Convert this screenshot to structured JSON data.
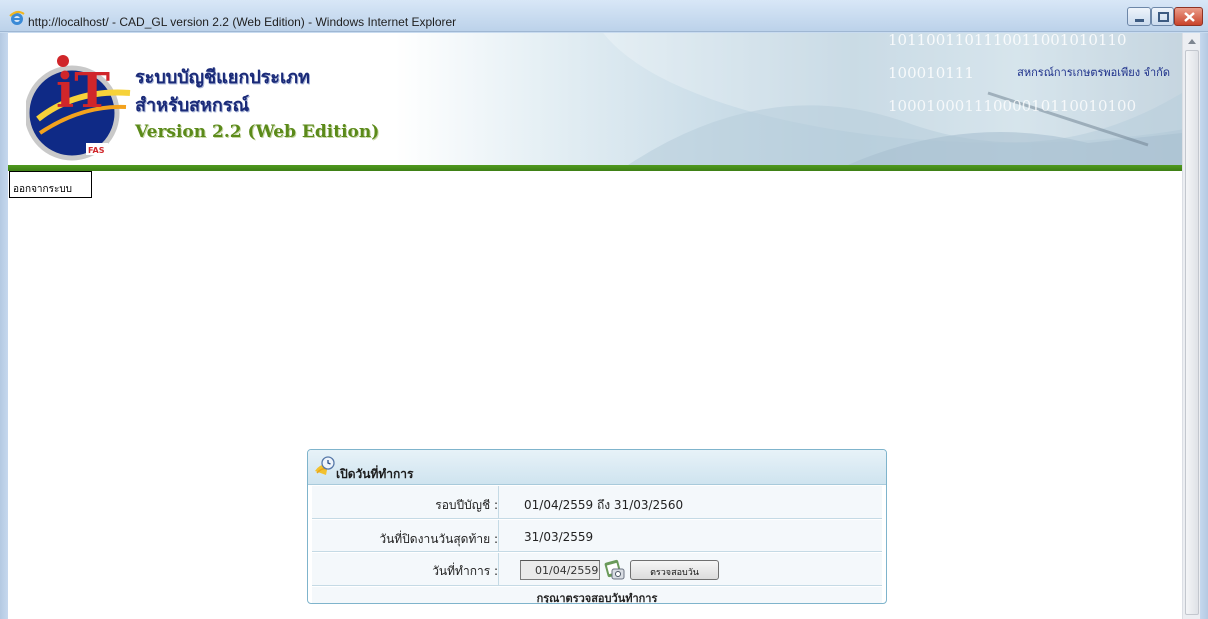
{
  "window": {
    "title": "http://localhost/ - CAD_GL version 2.2 (Web Edition) - Windows Internet Explorer"
  },
  "banner": {
    "system_title": "ระบบบัญชีแยกประเภท",
    "system_subtitle": "สำหรับสหกรณ์",
    "version": "Version 2.2 (Web Edition)",
    "coop_name": "สหกรณ์การเกษตรพอเพียง จำกัด",
    "logo_letters": "iT",
    "logo_badge": "FAS",
    "binary_row_1": "1011001101110011001010110",
    "binary_row_2": "100010111",
    "binary_row_3": "10001000111000010110010100"
  },
  "nav": {
    "logout_label": "ออกจากระบบ"
  },
  "panel": {
    "title": "เปิดวันที่ทำการ",
    "period_label": "รอบปีบัญชี :",
    "period_value": "01/04/2559 ถึง 31/03/2560",
    "last_close_label": "วันที่ปิดงานวันสุดท้าย :",
    "last_close_value": "31/03/2559",
    "work_date_label": "วันที่ทำการ :",
    "work_date_value": "01/04/2559",
    "check_button_label": "ตรวจสอบวัน",
    "message": "กรุณาตรวจสอบวันทำการ"
  },
  "colors": {
    "accent_green": "#3d7f15",
    "title_blue": "#1a2a78",
    "panel_border": "#7fb4cc"
  },
  "icons": [
    "ie-icon",
    "minimize-icon",
    "maximize-icon",
    "close-icon",
    "scroll-up-icon",
    "clock-icon",
    "calendar-icon"
  ]
}
